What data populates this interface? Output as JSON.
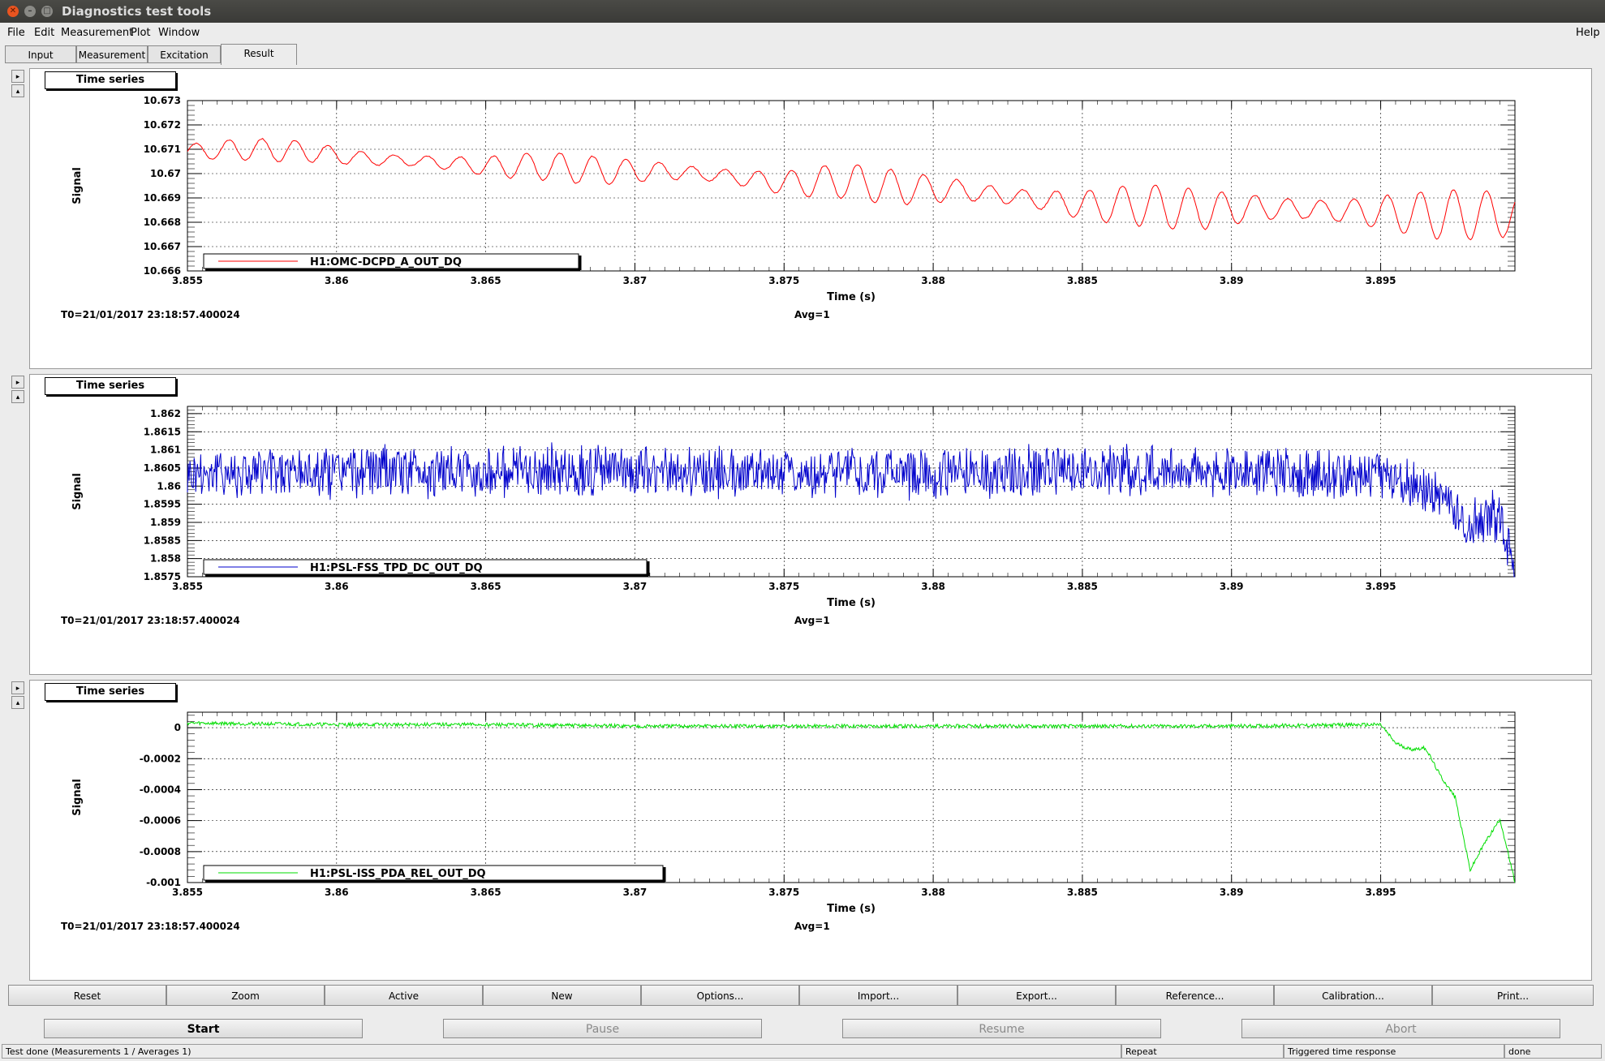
{
  "window": {
    "title": "Diagnostics test tools"
  },
  "menu": {
    "file": "File",
    "edit": "Edit",
    "measurement": "Measurement",
    "plot": "Plot",
    "window": "Window",
    "help": "Help"
  },
  "tabs": [
    {
      "label": "Input"
    },
    {
      "label": "Measurement"
    },
    {
      "label": "Excitation"
    },
    {
      "label": "Result"
    }
  ],
  "plots": [
    {
      "title": "Time series",
      "legend": "H1:OMC-DCPD_A_OUT_DQ",
      "color": "#ff0000",
      "ylabel": "Signal",
      "xlabel": "Time (s)",
      "t0": "T0=21/01/2017 23:18:57.400024",
      "avg": "Avg=1",
      "xticks": [
        "3.855",
        "3.86",
        "3.865",
        "3.87",
        "3.875",
        "3.88",
        "3.885",
        "3.89",
        "3.895"
      ],
      "yticks": [
        "10.673",
        "10.672",
        "10.671",
        "10.67",
        "10.669",
        "10.668",
        "10.667",
        "10.666"
      ]
    },
    {
      "title": "Time series",
      "legend": "H1:PSL-FSS_TPD_DC_OUT_DQ",
      "color": "#0000cc",
      "ylabel": "Signal",
      "xlabel": "Time (s)",
      "t0": "T0=21/01/2017 23:18:57.400024",
      "avg": "Avg=1",
      "xticks": [
        "3.855",
        "3.86",
        "3.865",
        "3.87",
        "3.875",
        "3.88",
        "3.885",
        "3.89",
        "3.895"
      ],
      "yticks": [
        "1.862",
        "1.8615",
        "1.861",
        "1.8605",
        "1.86",
        "1.8595",
        "1.859",
        "1.8585",
        "1.858",
        "1.8575"
      ]
    },
    {
      "title": "Time series",
      "legend": "H1:PSL-ISS_PDA_REL_OUT_DQ",
      "color": "#00dd00",
      "ylabel": "Signal",
      "xlabel": "Time (s)",
      "t0": "T0=21/01/2017 23:18:57.400024",
      "avg": "Avg=1",
      "xticks": [
        "3.855",
        "3.86",
        "3.865",
        "3.87",
        "3.875",
        "3.88",
        "3.885",
        "3.89",
        "3.895"
      ],
      "yticks": [
        "0",
        "-0.0002",
        "-0.0004",
        "-0.0006",
        "-0.0008",
        "-0.001"
      ]
    }
  ],
  "chart_data": [
    {
      "type": "line",
      "title": "Time series",
      "xlabel": "Time (s)",
      "ylabel": "Signal",
      "xlim": [
        3.855,
        3.8995
      ],
      "ylim": [
        10.666,
        10.673
      ],
      "grid": true,
      "legend_position": "bottom-left",
      "series": [
        {
          "name": "H1:OMC-DCPD_A_OUT_DQ",
          "x": [
            3.855,
            3.857,
            3.859,
            3.861,
            3.863,
            3.865,
            3.867,
            3.869,
            3.871,
            3.873,
            3.875,
            3.877,
            3.879,
            3.881,
            3.883,
            3.885,
            3.887,
            3.889,
            3.891,
            3.893,
            3.895,
            3.897,
            3.899
          ],
          "y": [
            10.6709,
            10.671,
            10.6709,
            10.6706,
            10.6705,
            10.6703,
            10.6703,
            10.6701,
            10.6701,
            10.6699,
            10.6696,
            10.6697,
            10.6694,
            10.6693,
            10.669,
            10.6687,
            10.6687,
            10.6685,
            10.6686,
            10.6685,
            10.6684,
            10.6683,
            10.6683
          ]
        }
      ]
    },
    {
      "type": "line",
      "title": "Time series",
      "xlabel": "Time (s)",
      "ylabel": "Signal",
      "xlim": [
        3.855,
        3.8995
      ],
      "ylim": [
        1.8575,
        1.8622
      ],
      "grid": true,
      "legend_position": "bottom-left",
      "series": [
        {
          "name": "H1:PSL-FSS_TPD_DC_OUT_DQ",
          "x": [
            3.855,
            3.86,
            3.865,
            3.87,
            3.875,
            3.88,
            3.885,
            3.89,
            3.895,
            3.897,
            3.898,
            3.899,
            3.8995
          ],
          "y": [
            1.8604,
            1.8604,
            1.8604,
            1.8604,
            1.8604,
            1.8604,
            1.8604,
            1.8604,
            1.8603,
            1.8597,
            1.859,
            1.8592,
            1.8576
          ]
        }
      ]
    },
    {
      "type": "line",
      "title": "Time series",
      "xlabel": "Time (s)",
      "ylabel": "Signal",
      "xlim": [
        3.855,
        3.8995
      ],
      "ylim": [
        -0.001,
        0.0001
      ],
      "grid": true,
      "legend_position": "bottom-left",
      "series": [
        {
          "name": "H1:PSL-ISS_PDA_REL_OUT_DQ",
          "x": [
            3.855,
            3.86,
            3.865,
            3.87,
            3.875,
            3.88,
            3.885,
            3.89,
            3.895,
            3.8955,
            3.896,
            3.8965,
            3.897,
            3.8975,
            3.898,
            3.8985,
            3.899,
            3.8995
          ],
          "y": [
            3e-05,
            2e-05,
            2e-05,
            1e-05,
            1e-05,
            1e-05,
            1e-05,
            1e-05,
            2e-05,
            -0.0001,
            -0.00014,
            -0.00013,
            -0.00031,
            -0.00045,
            -0.00092,
            -0.00074,
            -0.00059,
            -0.001
          ]
        }
      ]
    }
  ],
  "bottom_buttons": [
    "Reset",
    "Zoom",
    "Active",
    "New",
    "Options...",
    "Import...",
    "Export...",
    "Reference...",
    "Calibration...",
    "Print..."
  ],
  "controls": {
    "start": "Start",
    "pause": "Pause",
    "resume": "Resume",
    "abort": "Abort"
  },
  "status": {
    "message": "Test done (Measurements 1 / Averages 1)",
    "mode": "Repeat",
    "type": "Triggered time response",
    "state": "done"
  }
}
